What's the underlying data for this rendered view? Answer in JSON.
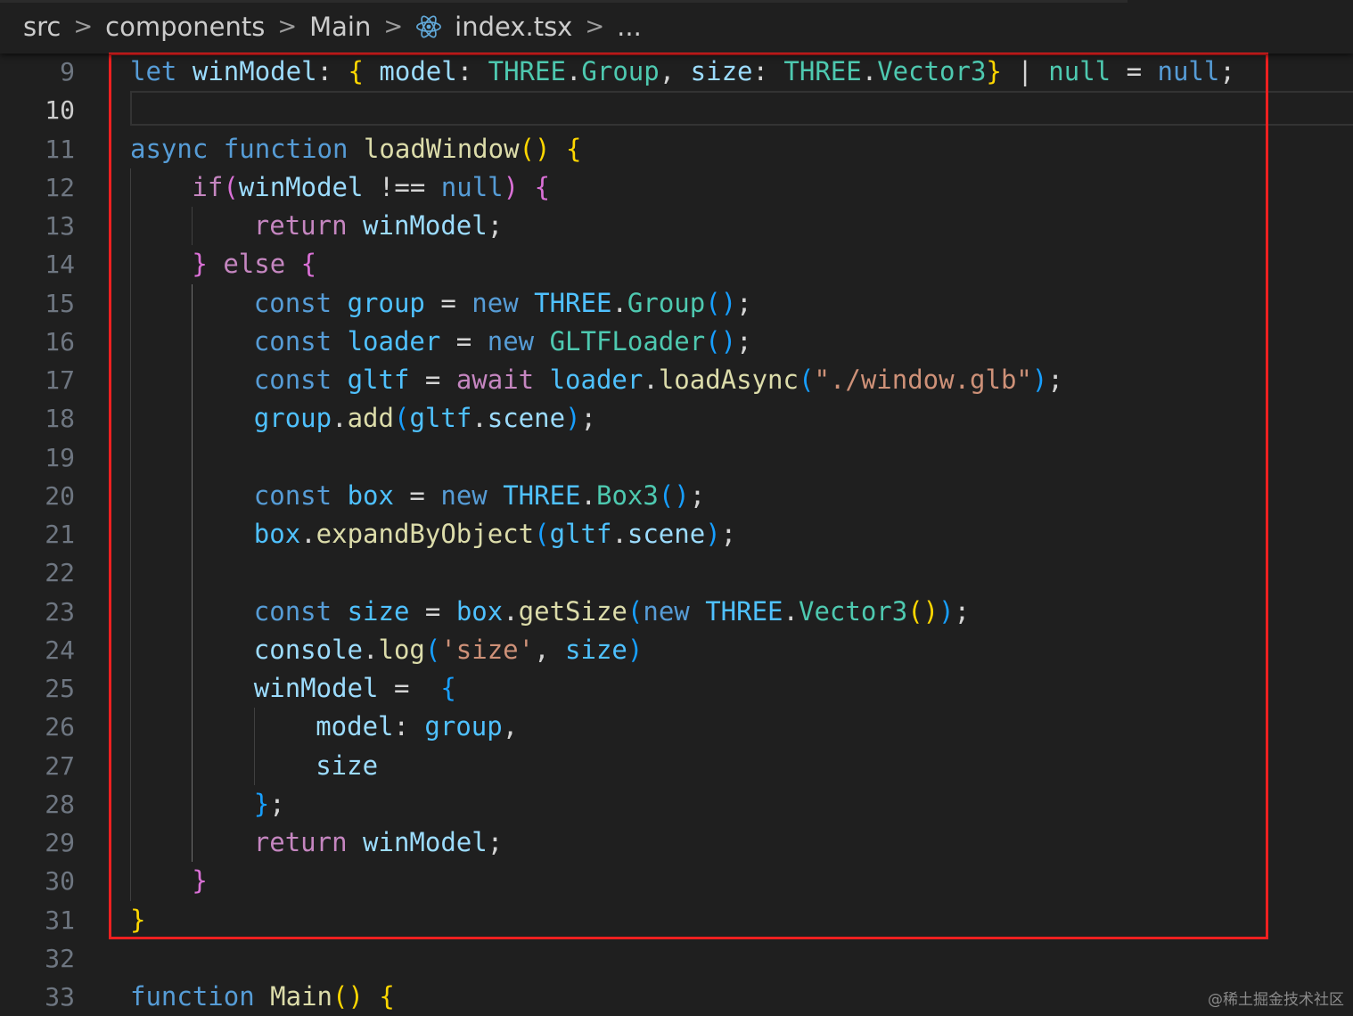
{
  "breadcrumb": {
    "items": [
      "src",
      "components",
      "Main",
      "index.tsx",
      "..."
    ],
    "separator": ">"
  },
  "editor": {
    "active_line": 10,
    "lines": [
      {
        "n": 9,
        "indent": 0,
        "tokens": [
          [
            "kw",
            "let"
          ],
          [
            "p",
            " "
          ],
          [
            "var",
            "winModel"
          ],
          [
            "p",
            ": "
          ],
          [
            "b1",
            "{"
          ],
          [
            "p",
            " "
          ],
          [
            "var",
            "model"
          ],
          [
            "p",
            ": "
          ],
          [
            "typ",
            "THREE"
          ],
          [
            "p",
            "."
          ],
          [
            "typ",
            "Group"
          ],
          [
            "p",
            ", "
          ],
          [
            "var",
            "size"
          ],
          [
            "p",
            ": "
          ],
          [
            "typ",
            "THREE"
          ],
          [
            "p",
            "."
          ],
          [
            "typ",
            "Vector3"
          ],
          [
            "b1",
            "}"
          ],
          [
            "p",
            " | "
          ],
          [
            "typ",
            "null"
          ],
          [
            "p",
            " = "
          ],
          [
            "kw",
            "null"
          ],
          [
            "p",
            ";"
          ]
        ]
      },
      {
        "n": 10,
        "indent": 0,
        "tokens": []
      },
      {
        "n": 11,
        "indent": 0,
        "tokens": [
          [
            "kw",
            "async"
          ],
          [
            "p",
            " "
          ],
          [
            "kw",
            "function"
          ],
          [
            "p",
            " "
          ],
          [
            "fn",
            "loadWindow"
          ],
          [
            "b1",
            "()"
          ],
          [
            "p",
            " "
          ],
          [
            "b1",
            "{"
          ]
        ]
      },
      {
        "n": 12,
        "indent": 1,
        "tokens": [
          [
            "ctl",
            "if"
          ],
          [
            "b2",
            "("
          ],
          [
            "var",
            "winModel"
          ],
          [
            "p",
            " !== "
          ],
          [
            "kw",
            "null"
          ],
          [
            "b2",
            ")"
          ],
          [
            "p",
            " "
          ],
          [
            "b2",
            "{"
          ]
        ]
      },
      {
        "n": 13,
        "indent": 2,
        "tokens": [
          [
            "ctl",
            "return"
          ],
          [
            "p",
            " "
          ],
          [
            "var",
            "winModel"
          ],
          [
            "p",
            ";"
          ]
        ]
      },
      {
        "n": 14,
        "indent": 1,
        "tokens": [
          [
            "b2",
            "}"
          ],
          [
            "p",
            " "
          ],
          [
            "ctl",
            "else"
          ],
          [
            "p",
            " "
          ],
          [
            "b2",
            "{"
          ]
        ]
      },
      {
        "n": 15,
        "indent": 2,
        "tokens": [
          [
            "kw",
            "const"
          ],
          [
            "p",
            " "
          ],
          [
            "cst",
            "group"
          ],
          [
            "p",
            " = "
          ],
          [
            "kw",
            "new"
          ],
          [
            "p",
            " "
          ],
          [
            "cst",
            "THREE"
          ],
          [
            "p",
            "."
          ],
          [
            "typ",
            "Group"
          ],
          [
            "b3",
            "()"
          ],
          [
            "p",
            ";"
          ]
        ]
      },
      {
        "n": 16,
        "indent": 2,
        "tokens": [
          [
            "kw",
            "const"
          ],
          [
            "p",
            " "
          ],
          [
            "cst",
            "loader"
          ],
          [
            "p",
            " = "
          ],
          [
            "kw",
            "new"
          ],
          [
            "p",
            " "
          ],
          [
            "typ",
            "GLTFLoader"
          ],
          [
            "b3",
            "()"
          ],
          [
            "p",
            ";"
          ]
        ]
      },
      {
        "n": 17,
        "indent": 2,
        "tokens": [
          [
            "kw",
            "const"
          ],
          [
            "p",
            " "
          ],
          [
            "cst",
            "gltf"
          ],
          [
            "p",
            " = "
          ],
          [
            "ctl",
            "await"
          ],
          [
            "p",
            " "
          ],
          [
            "cst",
            "loader"
          ],
          [
            "p",
            "."
          ],
          [
            "fn",
            "loadAsync"
          ],
          [
            "b3",
            "("
          ],
          [
            "str",
            "\"./window.glb\""
          ],
          [
            "b3",
            ")"
          ],
          [
            "p",
            ";"
          ]
        ]
      },
      {
        "n": 18,
        "indent": 2,
        "tokens": [
          [
            "cst",
            "group"
          ],
          [
            "p",
            "."
          ],
          [
            "fn",
            "add"
          ],
          [
            "b3",
            "("
          ],
          [
            "cst",
            "gltf"
          ],
          [
            "p",
            "."
          ],
          [
            "var",
            "scene"
          ],
          [
            "b3",
            ")"
          ],
          [
            "p",
            ";"
          ]
        ]
      },
      {
        "n": 19,
        "indent": 2,
        "tokens": []
      },
      {
        "n": 20,
        "indent": 2,
        "tokens": [
          [
            "kw",
            "const"
          ],
          [
            "p",
            " "
          ],
          [
            "cst",
            "box"
          ],
          [
            "p",
            " = "
          ],
          [
            "kw",
            "new"
          ],
          [
            "p",
            " "
          ],
          [
            "cst",
            "THREE"
          ],
          [
            "p",
            "."
          ],
          [
            "typ",
            "Box3"
          ],
          [
            "b3",
            "()"
          ],
          [
            "p",
            ";"
          ]
        ]
      },
      {
        "n": 21,
        "indent": 2,
        "tokens": [
          [
            "cst",
            "box"
          ],
          [
            "p",
            "."
          ],
          [
            "fn",
            "expandByObject"
          ],
          [
            "b3",
            "("
          ],
          [
            "cst",
            "gltf"
          ],
          [
            "p",
            "."
          ],
          [
            "var",
            "scene"
          ],
          [
            "b3",
            ")"
          ],
          [
            "p",
            ";"
          ]
        ]
      },
      {
        "n": 22,
        "indent": 2,
        "tokens": []
      },
      {
        "n": 23,
        "indent": 2,
        "tokens": [
          [
            "kw",
            "const"
          ],
          [
            "p",
            " "
          ],
          [
            "cst",
            "size"
          ],
          [
            "p",
            " = "
          ],
          [
            "cst",
            "box"
          ],
          [
            "p",
            "."
          ],
          [
            "fn",
            "getSize"
          ],
          [
            "b3",
            "("
          ],
          [
            "kw",
            "new"
          ],
          [
            "p",
            " "
          ],
          [
            "cst",
            "THREE"
          ],
          [
            "p",
            "."
          ],
          [
            "typ",
            "Vector3"
          ],
          [
            "b1",
            "()"
          ],
          [
            "b3",
            ")"
          ],
          [
            "p",
            ";"
          ]
        ]
      },
      {
        "n": 24,
        "indent": 2,
        "tokens": [
          [
            "var",
            "console"
          ],
          [
            "p",
            "."
          ],
          [
            "fn",
            "log"
          ],
          [
            "b3",
            "("
          ],
          [
            "str",
            "'size'"
          ],
          [
            "p",
            ", "
          ],
          [
            "cst",
            "size"
          ],
          [
            "b3",
            ")"
          ]
        ]
      },
      {
        "n": 25,
        "indent": 2,
        "tokens": [
          [
            "var",
            "winModel"
          ],
          [
            "p",
            " =  "
          ],
          [
            "b3",
            "{"
          ]
        ]
      },
      {
        "n": 26,
        "indent": 3,
        "tokens": [
          [
            "var",
            "model"
          ],
          [
            "p",
            ": "
          ],
          [
            "cst",
            "group"
          ],
          [
            "p",
            ","
          ]
        ]
      },
      {
        "n": 27,
        "indent": 3,
        "tokens": [
          [
            "var",
            "size"
          ]
        ]
      },
      {
        "n": 28,
        "indent": 2,
        "tokens": [
          [
            "b3",
            "}"
          ],
          [
            "p",
            ";"
          ]
        ]
      },
      {
        "n": 29,
        "indent": 2,
        "tokens": [
          [
            "ctl",
            "return"
          ],
          [
            "p",
            " "
          ],
          [
            "var",
            "winModel"
          ],
          [
            "p",
            ";"
          ]
        ]
      },
      {
        "n": 30,
        "indent": 1,
        "tokens": [
          [
            "b2",
            "}"
          ]
        ]
      },
      {
        "n": 31,
        "indent": 0,
        "tokens": [
          [
            "b1",
            "}"
          ]
        ]
      },
      {
        "n": 32,
        "indent": 0,
        "tokens": []
      },
      {
        "n": 33,
        "indent": 0,
        "tokens": [
          [
            "kw",
            "function"
          ],
          [
            "p",
            " "
          ],
          [
            "fn",
            "Main"
          ],
          [
            "b1",
            "()"
          ],
          [
            "p",
            " "
          ],
          [
            "b1",
            "{"
          ]
        ]
      }
    ]
  },
  "highlight": {
    "color": "#ee2020"
  },
  "watermark": "@稀土掘金技术社区"
}
